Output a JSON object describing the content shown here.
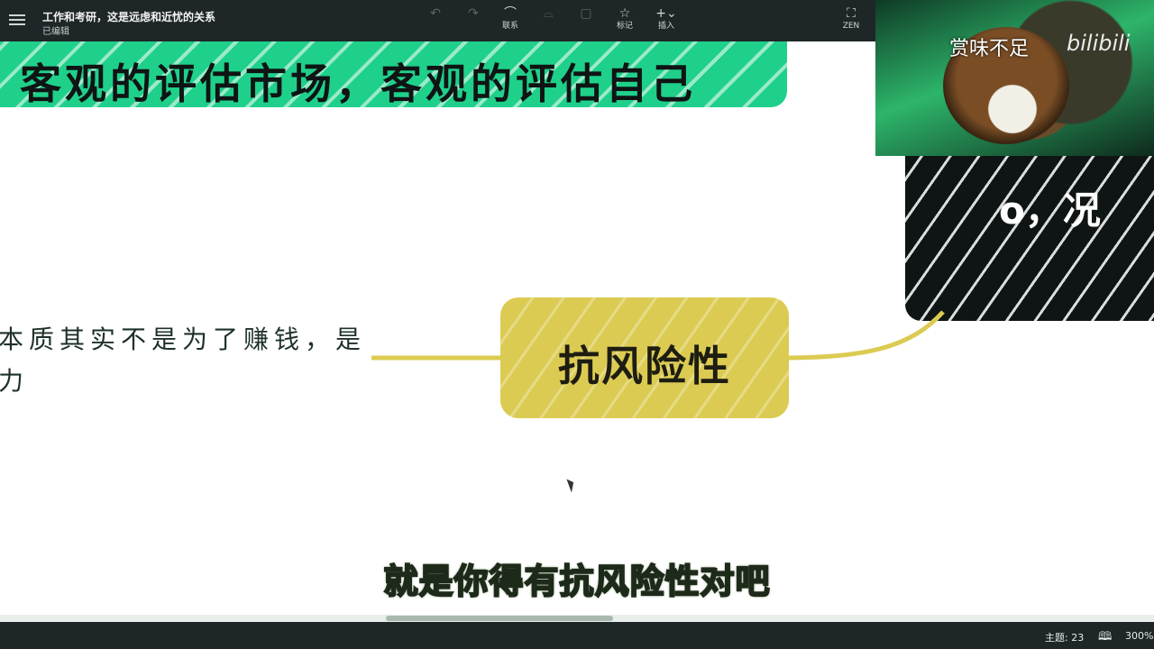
{
  "topbar": {
    "title": "工作和考研，这是远虑和近忧的关系",
    "status": "已编辑",
    "tools": [
      {
        "label": "",
        "icon": "undo-icon",
        "glyph": "↶"
      },
      {
        "label": "",
        "icon": "redo-icon",
        "glyph": "↷"
      },
      {
        "label": "联系",
        "icon": "link-icon",
        "glyph": "⌒"
      },
      {
        "label": "",
        "icon": "summary-icon",
        "glyph": "⌓"
      },
      {
        "label": "",
        "icon": "boundary-icon",
        "glyph": "▢"
      },
      {
        "label": "标记",
        "icon": "star-icon",
        "glyph": "☆"
      },
      {
        "label": "插入",
        "icon": "plus-icon",
        "glyph": "+⌄"
      },
      {
        "label": "ZEN",
        "icon": "fullscreen-icon",
        "glyph": "⛶"
      }
    ]
  },
  "canvas": {
    "green_card_text": "客观的评估市场，客观的评估自己",
    "dark_card_text": "o，况",
    "left_text_line1": "本质其实不是为了赚钱，是",
    "left_text_line2": "力",
    "node_text": "抗风险性",
    "subtitle": "就是你得有抗风险性对吧"
  },
  "webcam": {
    "caption": "赏味不足",
    "brand": "bilibili"
  },
  "statusbar": {
    "topic_count": "主题: 23",
    "zoom": "300%"
  },
  "colors": {
    "green": "#1fd08a",
    "yellow": "#dccb52",
    "dark": "#0f1414",
    "toolbar": "#1e2628"
  }
}
